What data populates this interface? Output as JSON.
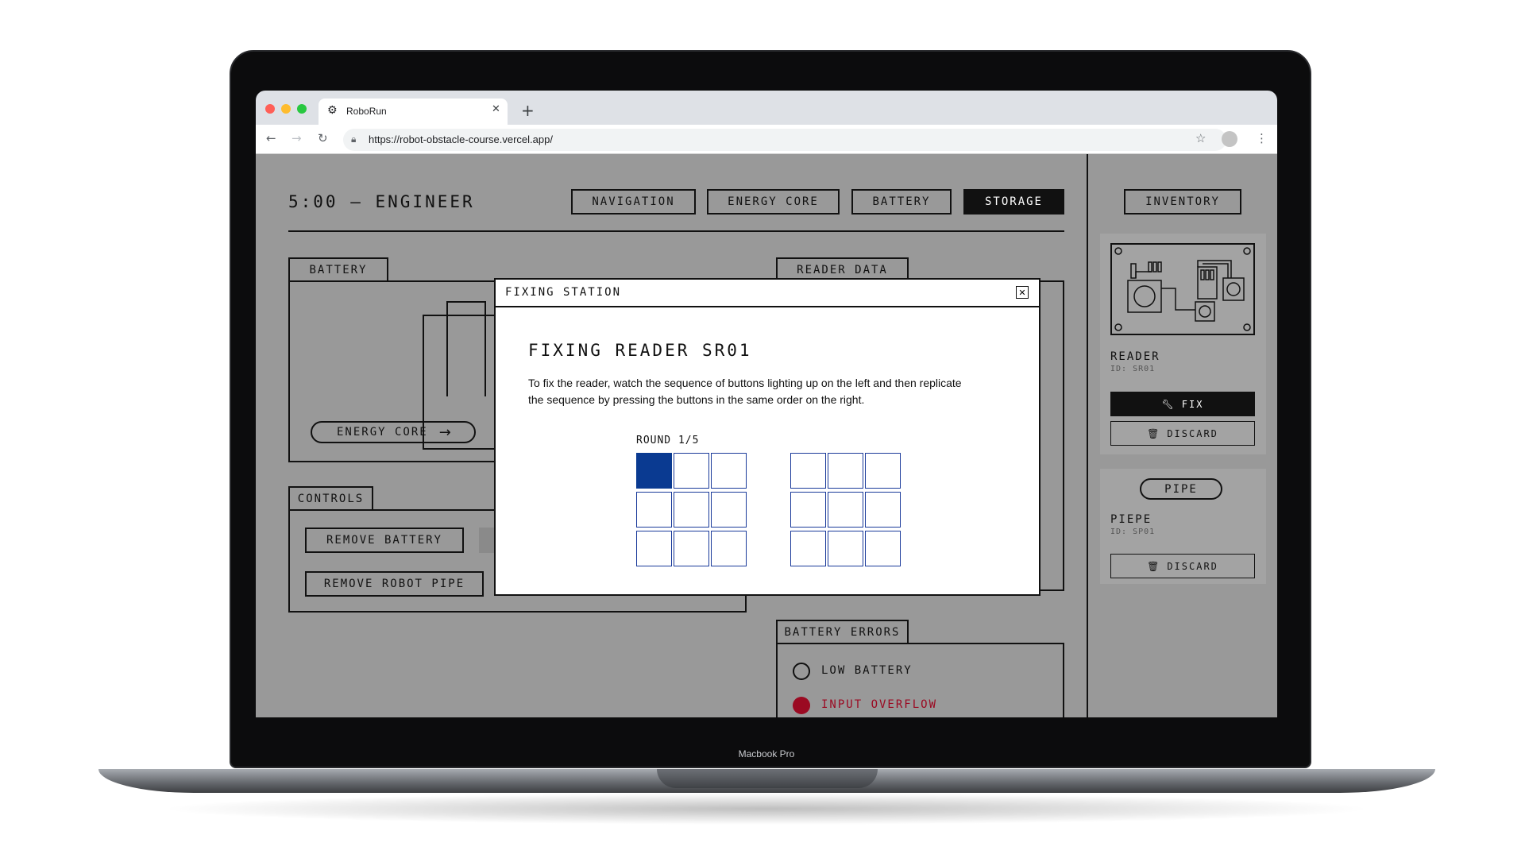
{
  "browser": {
    "tab_title": "RoboRun",
    "url": "https://robot-obstacle-course.vercel.app/"
  },
  "device_label": "Macbook Pro",
  "header": {
    "timer_title": "5:00 — ENGINEER",
    "nav": [
      "NAVIGATION",
      "ENERGY CORE",
      "BATTERY",
      "STORAGE"
    ],
    "active_nav": "STORAGE"
  },
  "battery_panel": {
    "tag": "BATTERY",
    "connector_label": "ENERGY CORE"
  },
  "reader_panel": {
    "tag": "READER DATA"
  },
  "controls": {
    "tag": "CONTROLS",
    "buttons": [
      "REMOVE BATTERY",
      "REMOVE ROBOT PIPE"
    ]
  },
  "battery_errors": {
    "tag": "BATTERY ERRORS",
    "items": [
      {
        "label": "LOW BATTERY",
        "active": false
      },
      {
        "label": "INPUT OVERFLOW",
        "active": true
      }
    ]
  },
  "modal": {
    "header": "FIXING STATION",
    "title": "FIXING READER SR01",
    "description": "To fix the reader, watch the sequence of buttons lighting up on the left and then replicate the sequence by pressing the buttons in the same order on the right.",
    "round_label": "ROUND 1/5",
    "left_grid_lit_index": 0
  },
  "inventory": {
    "title": "INVENTORY",
    "items": [
      {
        "name": "READER",
        "id": "ID: SR01",
        "fix_label": "FIX",
        "discard_label": "DISCARD"
      },
      {
        "pill": "PIPE",
        "name": "PIEPE",
        "id": "ID: SP01",
        "discard_label": "DISCARD"
      }
    ]
  },
  "colors": {
    "background": "#999999",
    "accent_blue": "#0a3a91",
    "error_red": "#9b0a22",
    "dark": "#111111"
  }
}
